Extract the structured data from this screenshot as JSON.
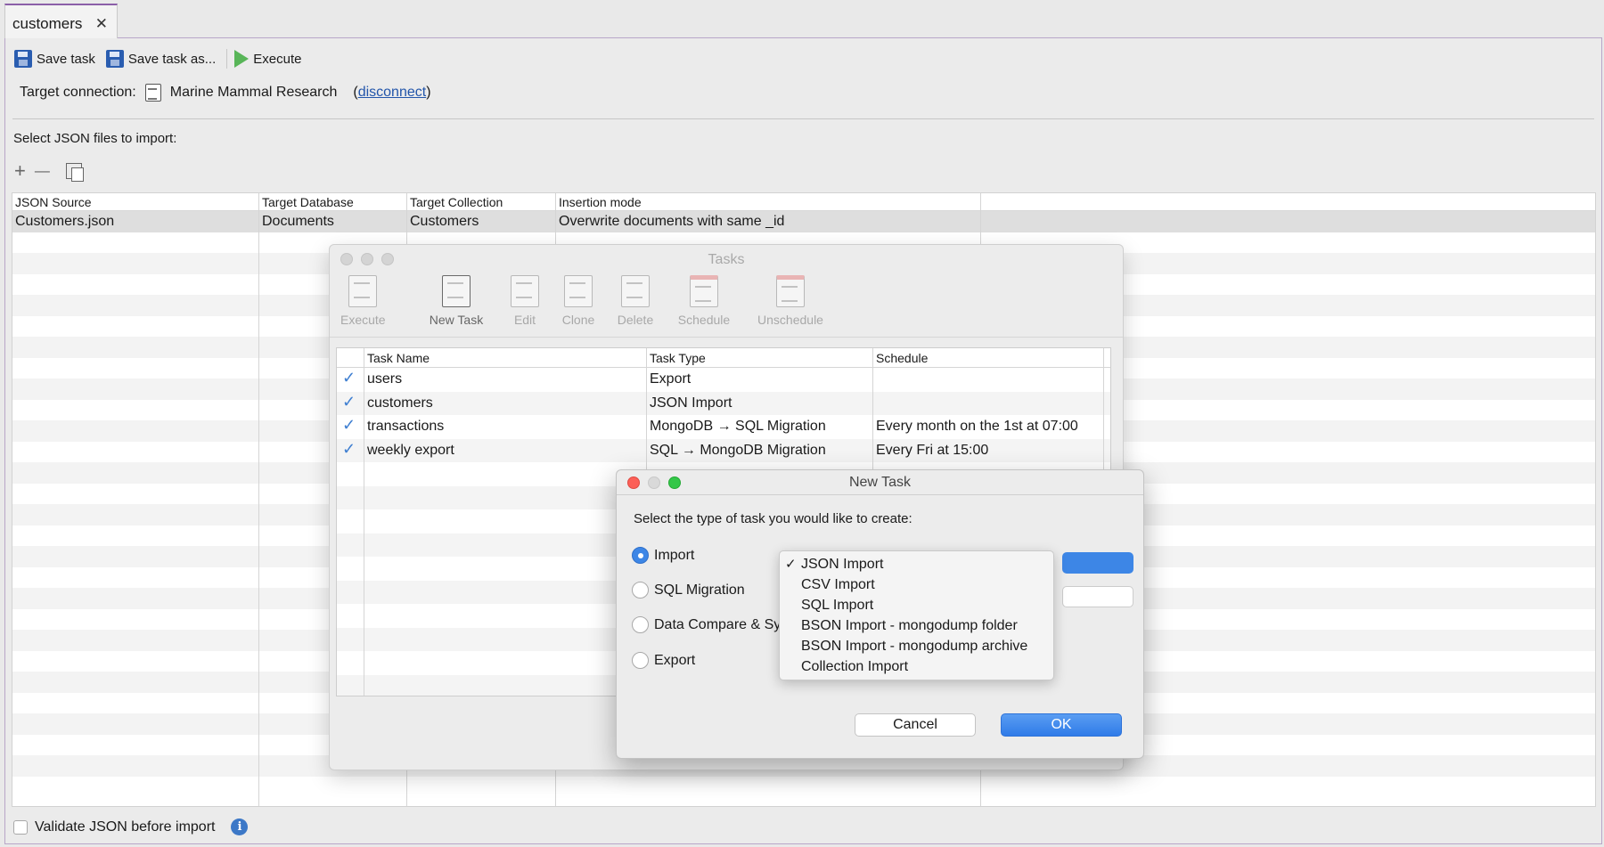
{
  "tab": {
    "label": "customers",
    "close": "✕"
  },
  "toolbar": {
    "save": "Save task",
    "save_as": "Save task as...",
    "execute": "Execute"
  },
  "target": {
    "label": "Target connection:",
    "name": "Marine Mammal Research",
    "open": "(",
    "link": "disconnect",
    "close": ")"
  },
  "select_label": "Select JSON files to import:",
  "mini_tools": {
    "add": "+",
    "remove": "—"
  },
  "grid": {
    "headers": [
      "JSON Source",
      "Target Database",
      "Target Collection",
      "Insertion mode"
    ],
    "row": [
      "Customers.json",
      "Documents",
      "Customers",
      "Overwrite documents with same _id"
    ]
  },
  "validate": {
    "label": "Validate JSON before import",
    "info": "i"
  },
  "tasks": {
    "title": "Tasks",
    "tools": [
      "Execute",
      "New Task",
      "Edit",
      "Clone",
      "Delete",
      "Schedule",
      "Unschedule"
    ],
    "headers": [
      "Task Name",
      "Task Type",
      "Schedule"
    ],
    "rows": [
      {
        "check": "✓",
        "name": "users",
        "type": "Export",
        "schedule": ""
      },
      {
        "check": "✓",
        "name": "customers",
        "type": "JSON Import",
        "schedule": ""
      },
      {
        "check": "✓",
        "name": "transactions",
        "type": "MongoDB → SQL Migration",
        "schedule": "Every month on the 1st at 07:00"
      },
      {
        "check": "✓",
        "name": "weekly export",
        "type": "SQL → MongoDB Migration",
        "schedule": "Every Fri at 15:00"
      }
    ]
  },
  "dialog": {
    "title": "New Task",
    "question": "Select the type of task you would like to create:",
    "radios": [
      "Import",
      "SQL Migration",
      "Data Compare & Sync",
      "Export"
    ],
    "selected_radio": "Import",
    "menu": [
      "JSON Import",
      "CSV Import",
      "SQL Import",
      "BSON Import - mongodump folder",
      "BSON Import - mongodump archive",
      "Collection Import"
    ],
    "menu_checked": "✓",
    "cancel": "Cancel",
    "ok": "OK"
  },
  "colors": {
    "accent": "#3d86e6",
    "tab_top": "#8b5fa8",
    "link": "#2255aa"
  }
}
